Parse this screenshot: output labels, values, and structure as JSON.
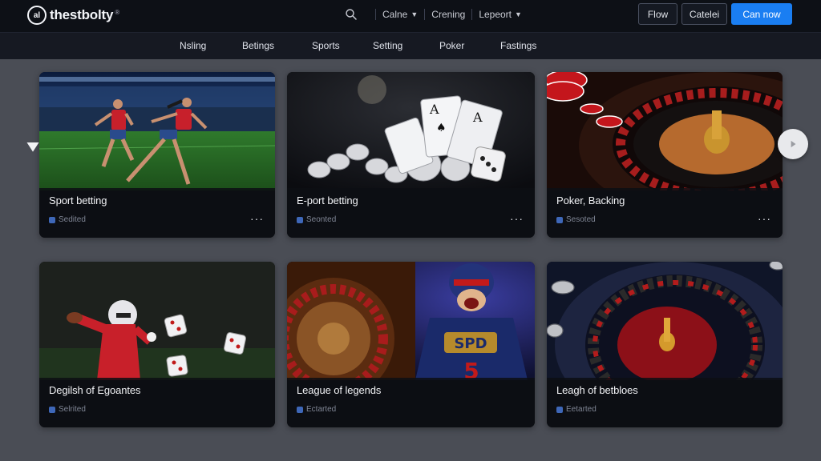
{
  "brand": {
    "name": "thestbolty",
    "mark": "al",
    "reg": "®"
  },
  "topnav": {
    "items": [
      {
        "label": "Calne",
        "has_dropdown": true
      },
      {
        "label": "Crening",
        "has_dropdown": false
      },
      {
        "label": "Lepeort",
        "has_dropdown": true
      }
    ],
    "buttons": {
      "flow": "Flow",
      "catelei": "Catelei",
      "cta": "Can now"
    }
  },
  "subnav": [
    "Nsling",
    "Betings",
    "Sports",
    "Setting",
    "Poker",
    "Fastings"
  ],
  "cards": [
    {
      "title": "Sport betting",
      "tag": "Sedited",
      "scene": "soccer"
    },
    {
      "title": "E-port betting",
      "tag": "Seonted",
      "scene": "cards"
    },
    {
      "title": "Poker, Backing",
      "tag": "Sesoted",
      "scene": "roulette-top"
    },
    {
      "title": "Degilsh of Egoantes",
      "tag": "Selrited",
      "scene": "football-dice"
    },
    {
      "title": "League of legends",
      "tag": "Ectarted",
      "scene": "roulette-player"
    },
    {
      "title": "Leagh of betbloes",
      "tag": "Eetarted",
      "scene": "roulette-red"
    }
  ],
  "colors": {
    "accent": "#1a7ef2",
    "background": "#4a4d55",
    "topbar": "#0d1016"
  },
  "icons": {
    "search": "search-icon",
    "more": "more-dots-icon",
    "prev": "arrow-left-icon",
    "next": "arrow-right-icon"
  }
}
